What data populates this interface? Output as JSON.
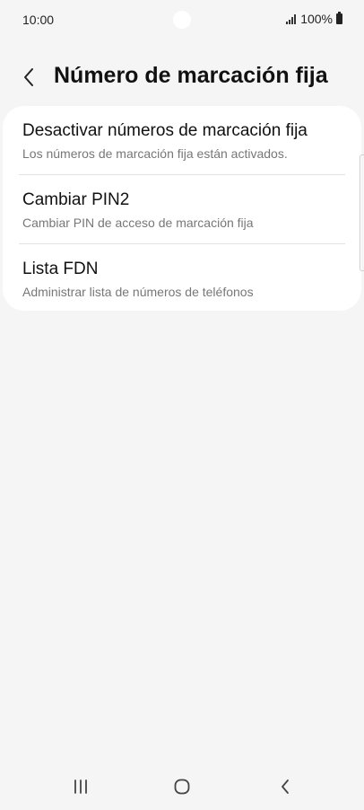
{
  "status_bar": {
    "time": "10:00",
    "battery": "100%"
  },
  "header": {
    "title": "Número de marcación fija"
  },
  "items": [
    {
      "title": "Desactivar números de marcación fija",
      "subtitle": "Los números de marcación fija están activados."
    },
    {
      "title": "Cambiar PIN2",
      "subtitle": "Cambiar PIN de acceso de marcación fija"
    },
    {
      "title": "Lista FDN",
      "subtitle": "Administrar lista de números de teléfonos"
    }
  ],
  "icons": {
    "back": "chevron-left-icon",
    "recents": "recents-icon",
    "home": "home-icon",
    "nav_back": "nav-back-icon"
  },
  "colors": {
    "background": "#f5f5f5",
    "card": "#ffffff",
    "subtitle": "#777777"
  }
}
